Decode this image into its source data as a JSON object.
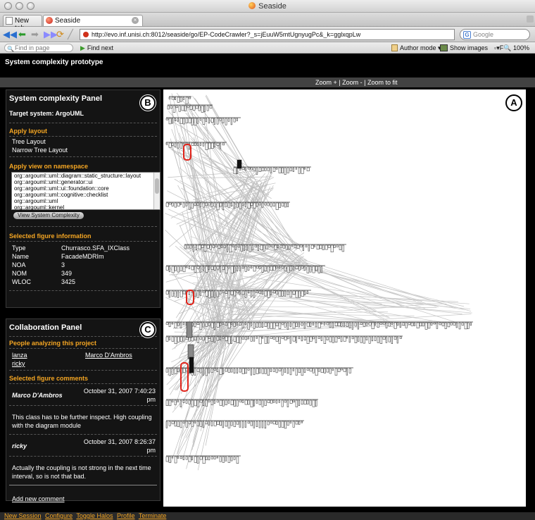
{
  "window": {
    "title": "Seaside"
  },
  "tabs": [
    {
      "label": "New tab"
    },
    {
      "label": "Seaside"
    }
  ],
  "nav": {
    "url": "http://evo.inf.unisi.ch:8012/seaside/go/EP-CodeCrawler?_s=jEuuW5mtUgnyugPc&_k=gglxqpLw",
    "search_placeholder": "Google"
  },
  "findbar": {
    "find_placeholder": "Find in page",
    "find_next": "Find next",
    "author_mode": "Author mode",
    "show_images": "Show images",
    "zoom_level": "100%"
  },
  "page": {
    "title": "System complexity prototype",
    "zoom_in": "Zoom +",
    "zoom_out": "Zoom -",
    "zoom_fit": "Zoom to fit",
    "sep": "|"
  },
  "system_panel": {
    "title": "System complexity Panel",
    "badge": "B",
    "target": "Target system: ArgoUML",
    "apply_layout_head": "Apply layout",
    "layouts": [
      "Tree Layout",
      "Narrow Tree Layout"
    ],
    "apply_view_head": "Apply view on namespace",
    "namespaces": [
      "org::argouml::uml::diagram::static_structure::layout",
      "org::argouml::uml::generator::ui",
      "org::argouml::uml::ui::foundation::core",
      "org::argouml::uml::cognitive::checklist",
      "org::argouml::uml",
      "org::argouml::kernel"
    ],
    "view_button": "View System Complexity",
    "selected_head": "Selected figure information",
    "info": [
      {
        "key": "Type",
        "value": "Churrasco.SFA_IXClass"
      },
      {
        "key": "Name",
        "value": "FacadeMDRIm"
      },
      {
        "key": "NOA",
        "value": "3"
      },
      {
        "key": "NOM",
        "value": "349"
      },
      {
        "key": "WLOC",
        "value": "3425"
      }
    ]
  },
  "collab_panel": {
    "title": "Collaboration Panel",
    "badge": "C",
    "people_head": "People analyzing this project",
    "people": [
      "lanza",
      "Marco D'Ambros",
      "ricky"
    ],
    "comments_head": "Selected figure comments",
    "comments": [
      {
        "author": "Marco D'Ambros",
        "date": "October 31, 2007 7:40:23",
        "time_suffix": "pm",
        "text": "This class has to be further inspect. High coupling with the diagram module"
      },
      {
        "author": "ricky",
        "date": "October 31, 2007 8:26:37",
        "time_suffix": "pm",
        "text": "Actually the coupling is not strong in the next time interval, so is not that bad."
      }
    ],
    "add_comment": "Add new comment"
  },
  "canvas": {
    "badge": "A"
  },
  "footer": {
    "links": [
      "New Session",
      "Configure",
      "Toggle Halos",
      "Profile",
      "Terminate"
    ]
  }
}
